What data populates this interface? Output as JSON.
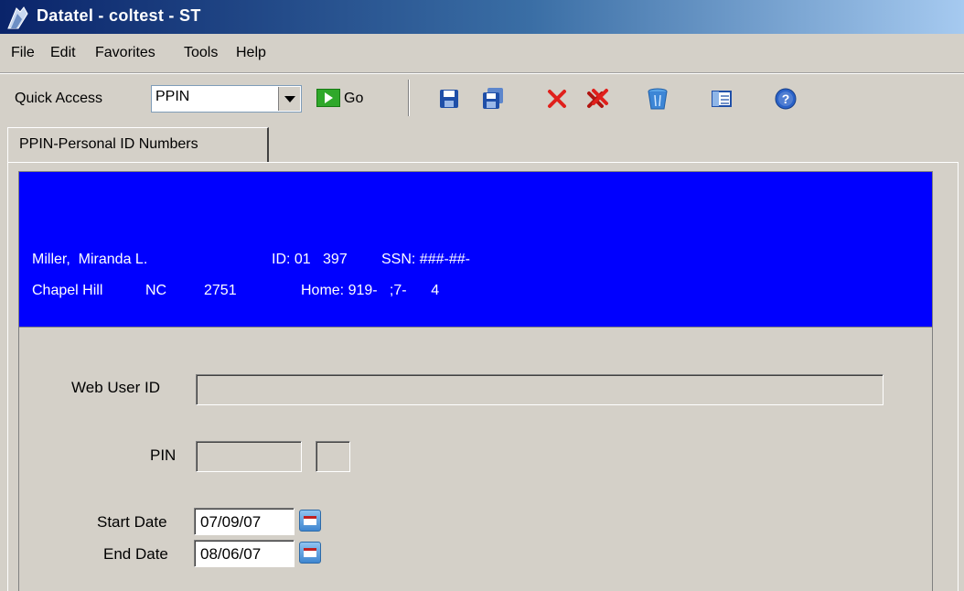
{
  "window": {
    "title": "Datatel - coltest - ST"
  },
  "menu": [
    "File",
    "Edit",
    "Favorites",
    "Tools",
    "Help"
  ],
  "toolbar": {
    "quick_access_label": "Quick Access",
    "quick_access_value": "PPIN",
    "go_label": "Go"
  },
  "tab": {
    "label": "PPIN-Personal ID Numbers"
  },
  "person": {
    "name": "Miller,  Miranda L.",
    "id": "ID: 01   397",
    "ssn": "SSN: ###-##-",
    "city": "Chapel Hill",
    "state": "NC",
    "zip": "2751",
    "home_phone": "Home: 919-   ;7-      4"
  },
  "form": {
    "web_user_id_label": "Web User ID",
    "web_user_id_value": "",
    "pin_label": "PIN",
    "start_date_label": "Start Date",
    "start_date_value": "07/09/07",
    "end_date_label": "End Date",
    "end_date_value": "08/06/07"
  }
}
